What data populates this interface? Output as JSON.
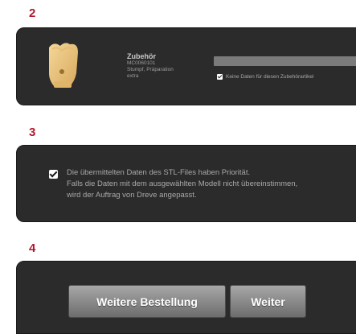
{
  "steps": {
    "step2": {
      "number": "2"
    },
    "step3": {
      "number": "3"
    },
    "step4": {
      "number": "4"
    }
  },
  "accessory": {
    "title": "Zubehör",
    "code": "MC0060101",
    "description_line1": "Stumpf, Präparation",
    "description_line2": "extra",
    "no_data_checked": true,
    "no_data_label": "Keine Daten für diesen Zubehörartikel"
  },
  "priority": {
    "checked": true,
    "line1": "Die übermittelten Daten des STL-Files haben Priorität.",
    "line2": "Falls die Daten mit dem ausgewählten Modell nicht übereinstimmen,",
    "line3": "wird der Auftrag von Dreve angepasst."
  },
  "actions": {
    "more_orders_label": "Weitere Bestellung",
    "next_label": "Weiter"
  },
  "colors": {
    "step_number": "#b0172a",
    "panel_bg": "#2b2b2b",
    "button_gradient_top": "#a7a7a7",
    "button_gradient_bottom": "#6d6d6d"
  },
  "icons": {
    "tooth": "tooth-model-icon",
    "checkbox": "checkbox-checked-icon"
  }
}
